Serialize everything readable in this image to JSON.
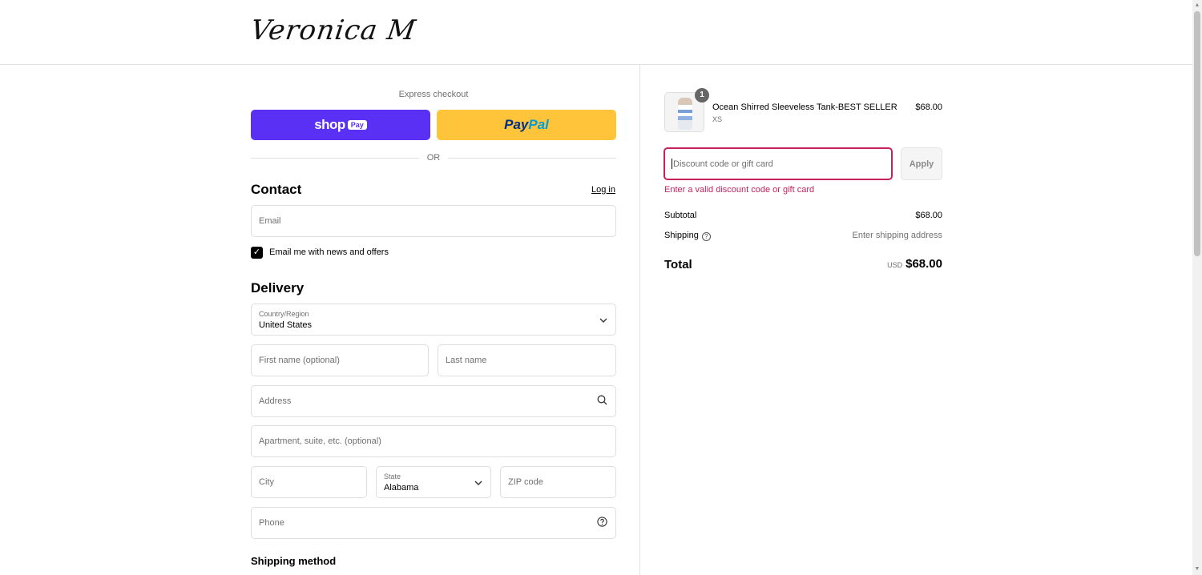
{
  "brand": {
    "logo_text": "Veronica M"
  },
  "express": {
    "label": "Express checkout",
    "shop_pay": {
      "text": "shop",
      "badge": "Pay"
    },
    "paypal": {
      "part1": "Pay",
      "part2": "Pal"
    },
    "or": "OR"
  },
  "contact": {
    "title": "Contact",
    "login": "Log in",
    "email_placeholder": "Email",
    "newsletter_label": "Email me with news and offers",
    "newsletter_checked": true
  },
  "delivery": {
    "title": "Delivery",
    "country_label": "Country/Region",
    "country_value": "United States",
    "first_name_placeholder": "First name (optional)",
    "last_name_placeholder": "Last name",
    "address_placeholder": "Address",
    "apartment_placeholder": "Apartment, suite, etc. (optional)",
    "city_placeholder": "City",
    "state_label": "State",
    "state_value": "Alabama",
    "zip_placeholder": "ZIP code",
    "phone_placeholder": "Phone"
  },
  "shipping_method": {
    "title": "Shipping method"
  },
  "order": {
    "item": {
      "name": "Ocean Shirred Sleeveless Tank-BEST SELLER",
      "variant": "XS",
      "price": "$68.00",
      "quantity": "1"
    },
    "discount_placeholder": "Discount code or gift card",
    "apply_label": "Apply",
    "error": "Enter a valid discount code or gift card",
    "subtotal_label": "Subtotal",
    "subtotal_value": "$68.00",
    "shipping_label": "Shipping",
    "shipping_value": "Enter shipping address",
    "total_label": "Total",
    "total_currency": "USD",
    "total_value": "$68.00"
  },
  "colors": {
    "shop_pay": "#5a31f4",
    "paypal": "#ffc439",
    "error": "#c4225c"
  },
  "icons": [
    "chevron-down-icon",
    "search-icon",
    "help-icon",
    "check-icon"
  ]
}
